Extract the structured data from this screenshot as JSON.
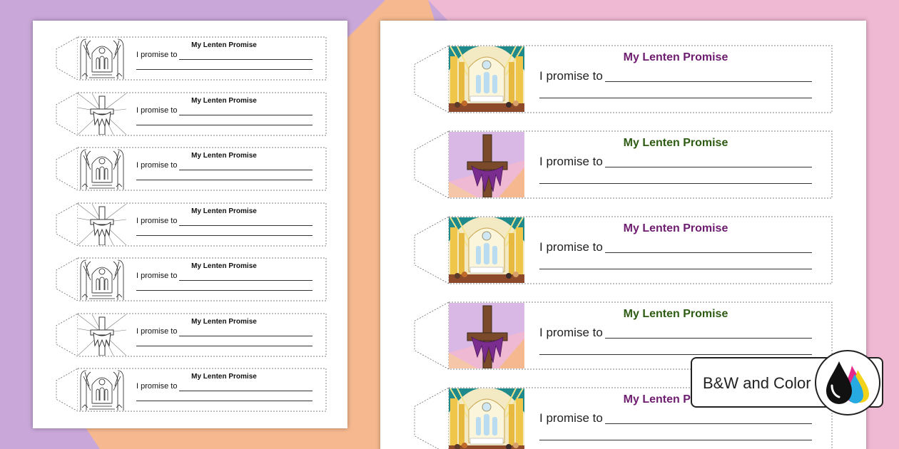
{
  "colors": {
    "bg_purple": "#c9a7d9",
    "bg_pink": "#efb8d3",
    "bg_orange": "#f6b98f",
    "title_purple": "#6d1c6f",
    "title_green": "#2d5b12"
  },
  "bw_sheet": {
    "bookmarks": [
      {
        "image": "church-altar-outline",
        "title": "My Lenten Promise",
        "promise": "I promise to"
      },
      {
        "image": "cross-outline",
        "title": "My Lenten Promise",
        "promise": "I promise to"
      },
      {
        "image": "church-altar-outline",
        "title": "My Lenten Promise",
        "promise": "I promise to"
      },
      {
        "image": "cross-outline",
        "title": "My Lenten Promise",
        "promise": "I promise to"
      },
      {
        "image": "church-altar-outline",
        "title": "My Lenten Promise",
        "promise": "I promise to"
      },
      {
        "image": "cross-outline",
        "title": "My Lenten Promise",
        "promise": "I promise to"
      },
      {
        "image": "church-altar-outline",
        "title": "My Lenten Promise",
        "promise": "I promise to"
      }
    ]
  },
  "color_sheet": {
    "bookmarks": [
      {
        "image": "church-altar-color",
        "title": "My Lenten Promise",
        "promise": "I promise to",
        "title_color": "#6d1c6f"
      },
      {
        "image": "purple-draped-cross-color",
        "title": "My Lenten Promise",
        "promise": "I promise to",
        "title_color": "#2d5b12"
      },
      {
        "image": "church-altar-color",
        "title": "My Lenten Promise",
        "promise": "I promise to",
        "title_color": "#6d1c6f"
      },
      {
        "image": "purple-draped-cross-color",
        "title": "My Lenten Promise",
        "promise": "I promise to",
        "title_color": "#2d5b12"
      },
      {
        "image": "church-altar-color",
        "title": "My Lenten Promise",
        "promise": "I promise to",
        "title_color": "#6d1c6f"
      }
    ]
  },
  "badge": {
    "label": "B&W and Color",
    "icon": "ink-drops-icon"
  }
}
